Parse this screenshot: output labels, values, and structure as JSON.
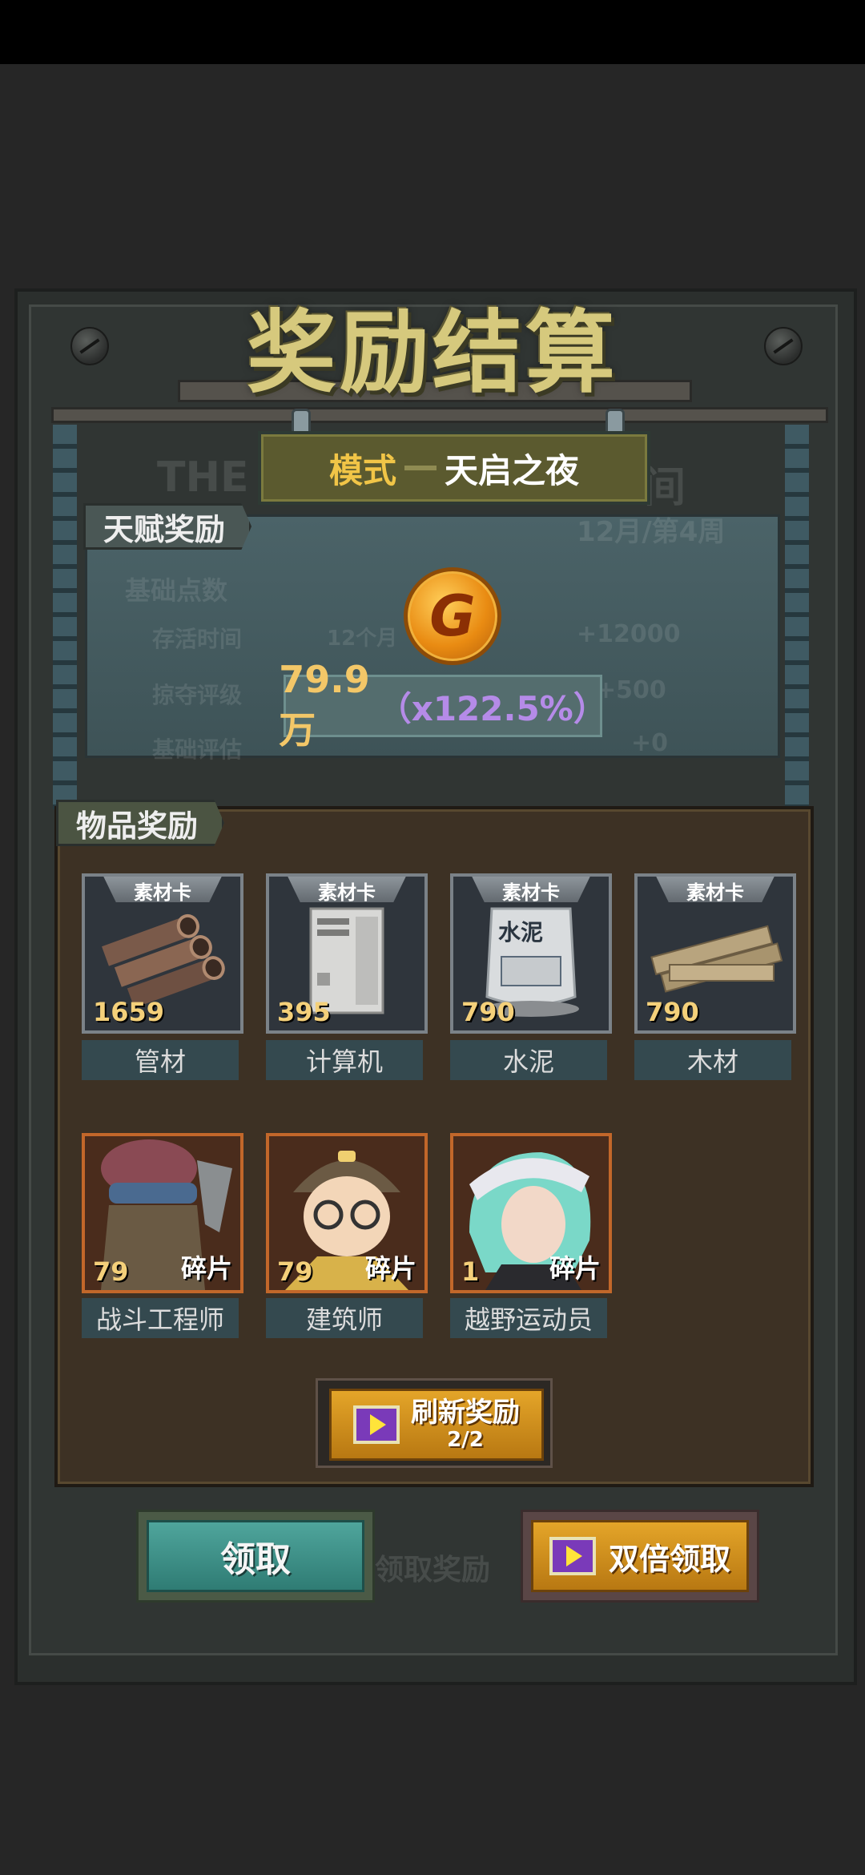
{
  "title": "奖励结算",
  "mode": {
    "label": "模式",
    "name": "天启之夜"
  },
  "background_ghost": {
    "the": "THE",
    "jian": "间",
    "date": "12月/第4周",
    "basic_points": "基础点数",
    "row1_label": "存活时间",
    "row1_mid": "12个月",
    "row1_value": "+12000",
    "row2_label": "掠夺评级",
    "row2_value": "+500",
    "row3_label": "基础评估",
    "row3_value": "+0",
    "claim_reward": "领取奖励"
  },
  "talent_section": {
    "label": "天赋奖励",
    "coin_icon": "gold-g-coin",
    "amount": "79.9万",
    "multiplier": "（x122.5%）"
  },
  "items_section": {
    "label": "物品奖励",
    "materials": [
      {
        "tag": "素材卡",
        "qty": "1659",
        "name": "管材"
      },
      {
        "tag": "素材卡",
        "qty": "395",
        "name": "计算机"
      },
      {
        "tag": "素材卡",
        "qty": "790",
        "name": "水泥",
        "art_text": "水泥"
      },
      {
        "tag": "素材卡",
        "qty": "790",
        "name": "木材"
      }
    ],
    "heroes": [
      {
        "qty": "79",
        "frag": "碎片",
        "name": "战斗工程师"
      },
      {
        "qty": "79",
        "frag": "碎片",
        "name": "建筑师"
      },
      {
        "qty": "1",
        "frag": "碎片",
        "name": "越野运动员"
      }
    ]
  },
  "buttons": {
    "refresh": {
      "label": "刷新奖励",
      "count": "2/2"
    },
    "claim": "领取",
    "double_claim": "双倍领取"
  },
  "colors": {
    "gold_text": "#f3c768",
    "multiplier": "#b58be8",
    "claim_teal": "#3f948b",
    "orange_button": "#d49220"
  }
}
